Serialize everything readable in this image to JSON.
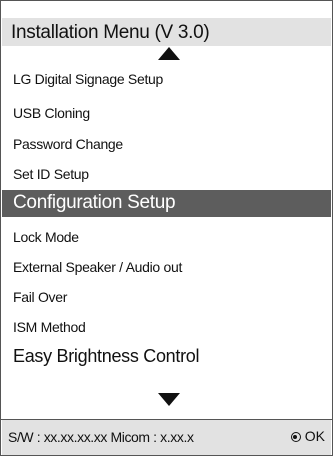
{
  "menu": {
    "title": "Installation Menu (V 3.0)",
    "items": [
      {
        "label": "LG Digital Signage Setup"
      },
      {
        "label": "USB Cloning"
      },
      {
        "label": "Password Change"
      },
      {
        "label": "Set ID Setup"
      },
      {
        "label": "Configuration Setup"
      },
      {
        "label": "Lock Mode"
      },
      {
        "label": "External Speaker / Audio out"
      },
      {
        "label": "Fail Over"
      },
      {
        "label": "ISM Method"
      },
      {
        "label": "Easy Brightness Control"
      }
    ],
    "selected_label": "Configuration Setup"
  },
  "footer": {
    "sw_text": "S/W : xx.xx.xx.xx Micom : x.xx.x",
    "ok_label": "OK"
  },
  "icons": {
    "scroll_up": "scroll-up-arrow-icon",
    "scroll_down": "scroll-down-arrow-icon",
    "ok": "ok-button-icon"
  },
  "colors": {
    "selected_background": "#5d5d5d",
    "bar_background": "#e2e2e2"
  }
}
